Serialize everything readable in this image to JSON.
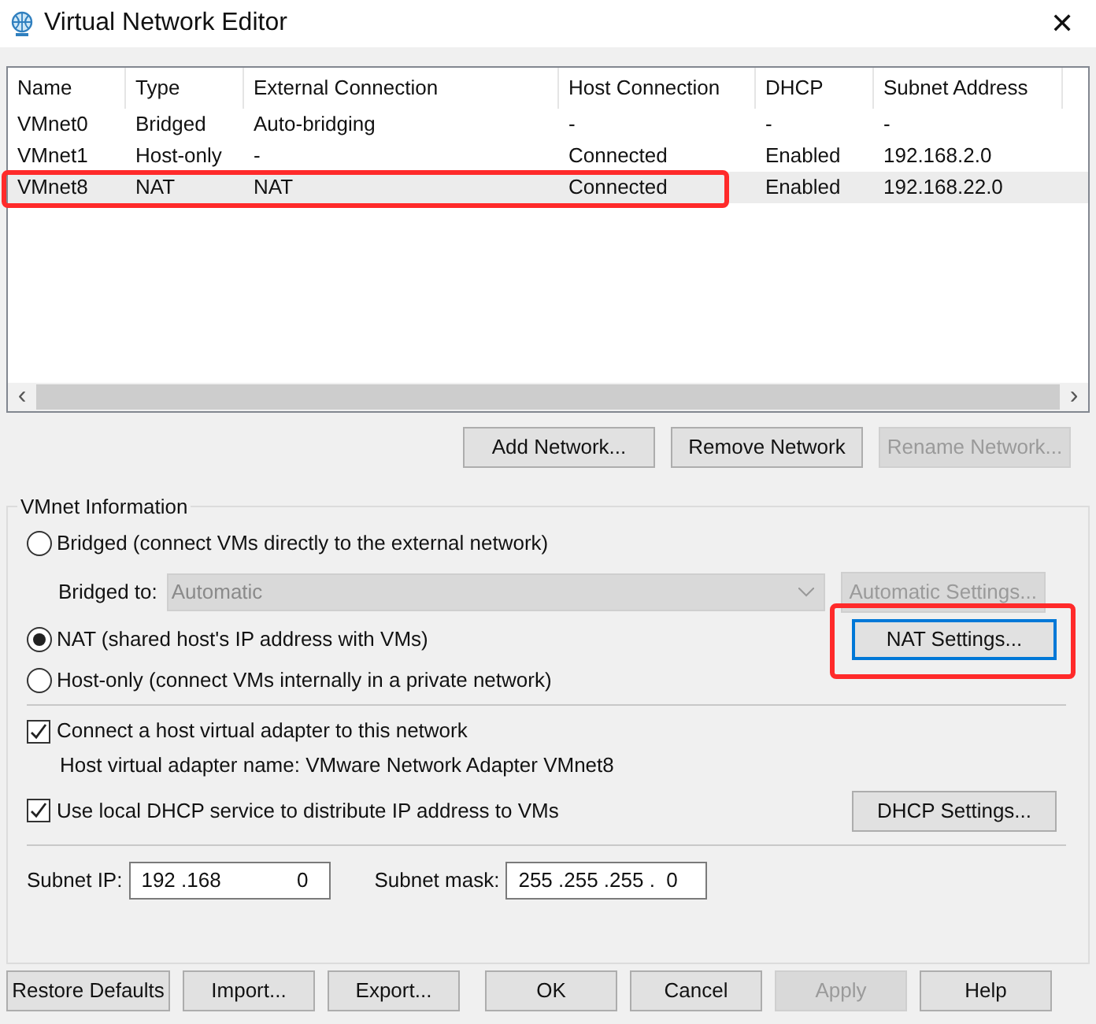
{
  "window": {
    "title": "Virtual Network Editor",
    "close": "✕"
  },
  "table": {
    "columns": [
      "Name",
      "Type",
      "External Connection",
      "Host Connection",
      "DHCP",
      "Subnet Address"
    ],
    "rows": [
      {
        "cells": [
          "VMnet0",
          "Bridged",
          "Auto-bridging",
          "-",
          "-",
          "-"
        ],
        "selected": false,
        "annotated": false
      },
      {
        "cells": [
          "VMnet1",
          "Host-only",
          "-",
          "Connected",
          "Enabled",
          "192.168.2.0"
        ],
        "selected": false,
        "annotated": false
      },
      {
        "cells": [
          "VMnet8",
          "NAT",
          "NAT",
          "Connected",
          "Enabled",
          "192.168.22.0"
        ],
        "selected": true,
        "annotated": true
      }
    ],
    "scroll_left": "‹",
    "scroll_right": "›"
  },
  "network_buttons": [
    {
      "label": "Add Network...",
      "disabled": false
    },
    {
      "label": "Remove Network",
      "disabled": false
    },
    {
      "label": "Rename Network...",
      "disabled": true
    }
  ],
  "vmnet_info": {
    "title": "VMnet Information",
    "bridged": {
      "label": "Bridged (connect VMs directly to the external network)",
      "selected": false
    },
    "bridged_to": {
      "label": "Bridged to:",
      "value": "Automatic",
      "disabled": true
    },
    "automatic_settings": {
      "label": "Automatic Settings...",
      "disabled": true
    },
    "nat": {
      "label": "NAT (shared host's IP address with VMs)",
      "selected": true
    },
    "nat_settings": {
      "label": "NAT Settings...",
      "annotated": true
    },
    "host_only": {
      "label": "Host-only (connect VMs internally in a private network)",
      "selected": false
    },
    "connect_adapter": {
      "label": "Connect a host virtual adapter to this network",
      "checked": true
    },
    "adapter_name": "Host virtual adapter name: VMware Network Adapter VMnet8",
    "use_dhcp": {
      "label": "Use local DHCP service to distribute IP address to VMs",
      "checked": true
    },
    "dhcp_settings": "DHCP Settings...",
    "subnet_ip": {
      "label": "Subnet IP:",
      "start": "192 .168",
      "end": "0"
    },
    "subnet_mask": {
      "label": "Subnet mask:",
      "value": "255 .255 .255 .  0"
    }
  },
  "footer_buttons": [
    {
      "label": "Restore Defaults",
      "disabled": false
    },
    {
      "label": "Import...",
      "disabled": false
    },
    {
      "label": "Export...",
      "disabled": false
    },
    {
      "label": "OK",
      "disabled": false
    },
    {
      "label": "Cancel",
      "disabled": false
    },
    {
      "label": "Apply",
      "disabled": true
    },
    {
      "label": "Help",
      "disabled": false
    }
  ]
}
